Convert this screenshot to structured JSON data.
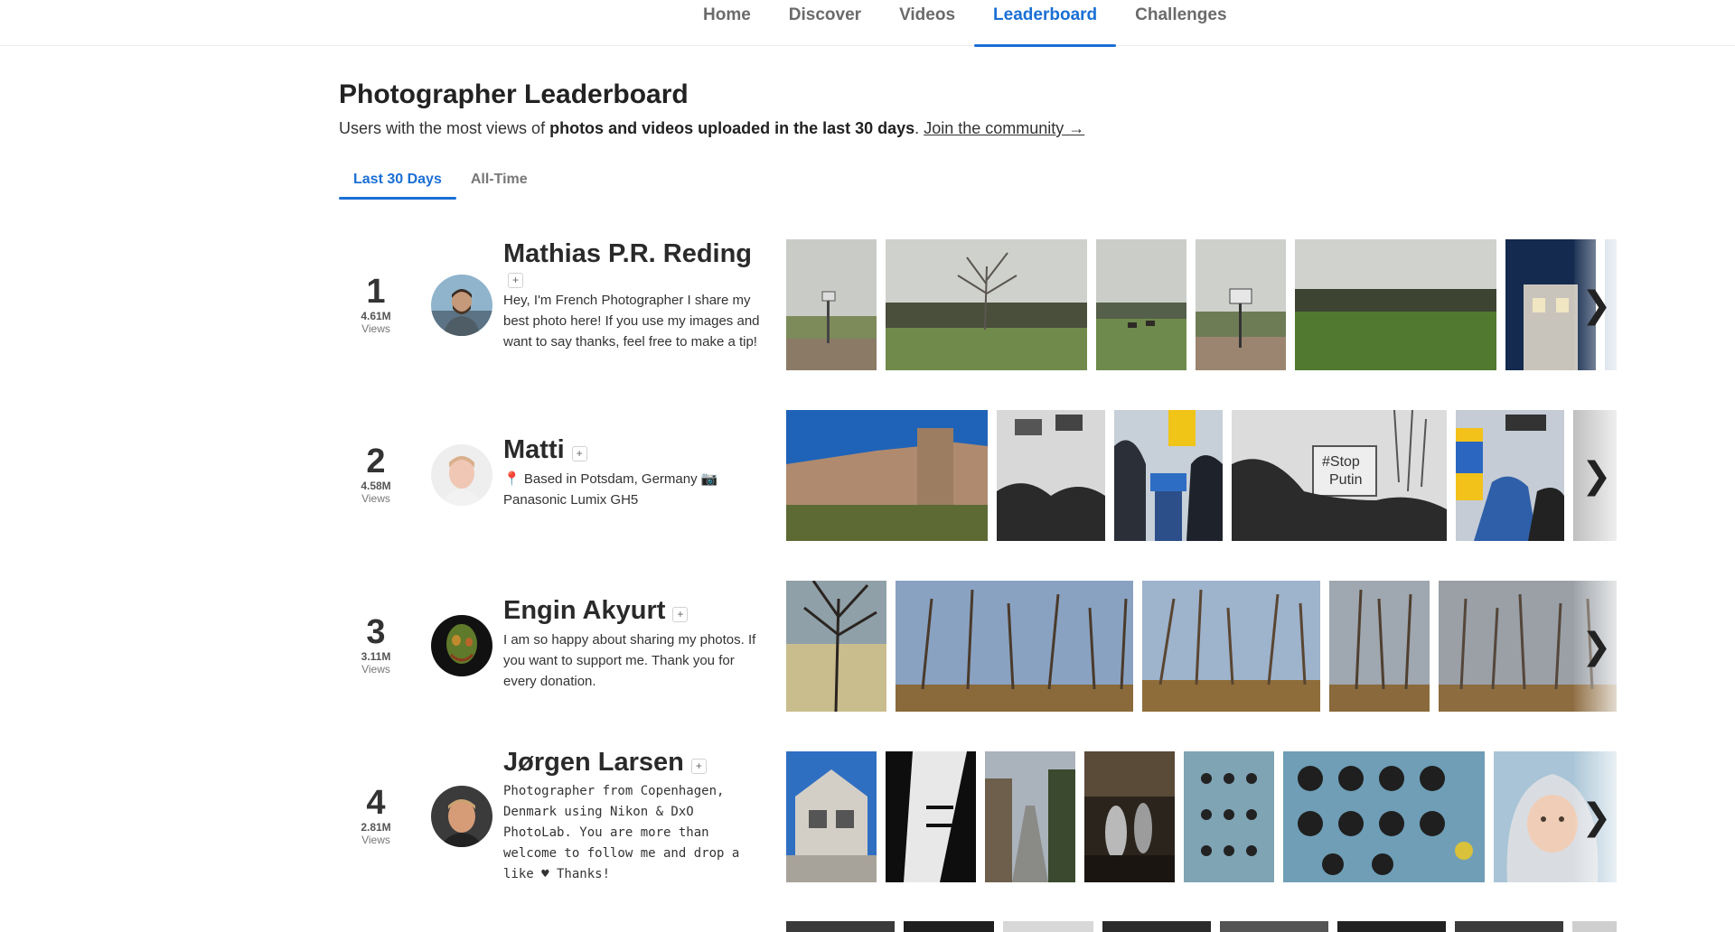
{
  "nav": {
    "tabs": [
      {
        "label": "Home"
      },
      {
        "label": "Discover"
      },
      {
        "label": "Videos"
      },
      {
        "label": "Leaderboard",
        "active": true
      },
      {
        "label": "Challenges"
      }
    ]
  },
  "header": {
    "title": "Photographer Leaderboard",
    "subtitle_prefix": "Users with the most views of ",
    "subtitle_bold": "photos and videos uploaded in the last 30 days",
    "subtitle_period": ".",
    "join_link": "Join the community →"
  },
  "period_tabs": [
    {
      "label": "Last 30 Days",
      "active": true
    },
    {
      "label": "All-Time",
      "active": false
    }
  ],
  "follow_symbol": "+",
  "next_symbol": "❯",
  "views_label": "Views",
  "leaders": [
    {
      "rank": "1",
      "views": "4.61M",
      "name": "Mathias P.R. Reding",
      "bio": "Hey, I'm French Photographer I share my best photo here! If you use my images and want to say thanks, feel free to make a tip!"
    },
    {
      "rank": "2",
      "views": "4.58M",
      "name": "Matti",
      "bio": "📍 Based in Potsdam, Germany 📷 Panasonic Lumix GH5"
    },
    {
      "rank": "3",
      "views": "3.11M",
      "name": "Engin Akyurt",
      "bio": "I am so happy about sharing my photos. If you want to support me. Thank you for every donation."
    },
    {
      "rank": "4",
      "views": "2.81M",
      "name": "Jørgen Larsen",
      "bio": "Photographer from Copenhagen, Denmark using Nikon & DxO PhotoLab. You are more than welcome to follow me and drop a like ♥ Thanks!"
    }
  ],
  "colors": {
    "accent": "#1a6fd4",
    "text": "#2e2e2e",
    "muted": "#777777"
  }
}
